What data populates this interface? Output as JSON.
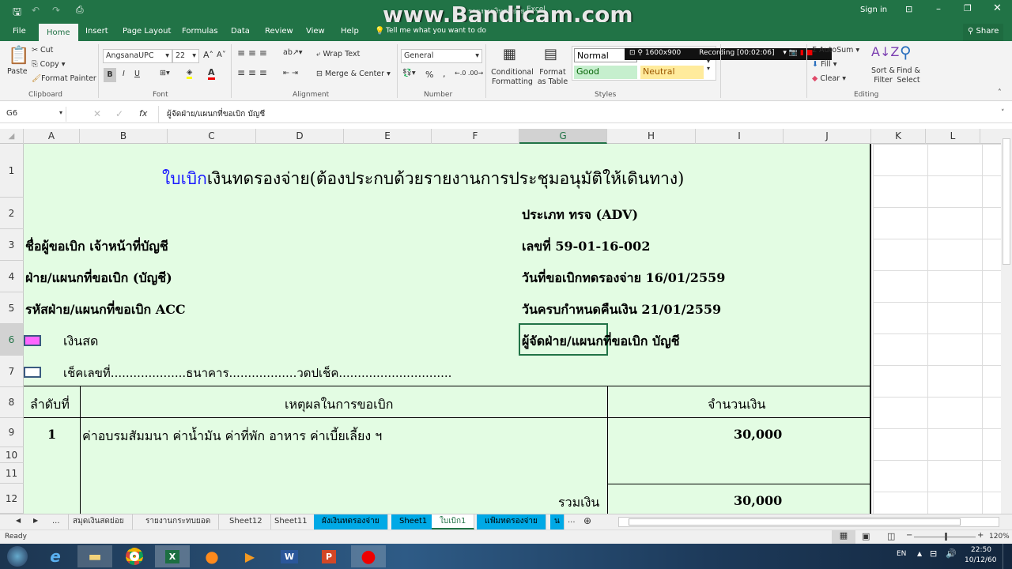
{
  "window": {
    "doc_title": "รายงานเงินสดย่อย",
    "app": "Excel",
    "sign_in": "Sign in",
    "share": "Share",
    "watermark": "www.Bandicam.com"
  },
  "qat": {
    "save": "save-icon",
    "undo": "undo-icon",
    "redo": "redo-icon",
    "preview": "print-preview-icon"
  },
  "ribbon_tabs": [
    "File",
    "Home",
    "Insert",
    "Page Layout",
    "Formulas",
    "Data",
    "Review",
    "View",
    "Help"
  ],
  "tell_me": "Tell me what you want to do",
  "clipboard": {
    "paste": "Paste",
    "cut": "Cut",
    "copy": "Copy",
    "format_painter": "Format Painter",
    "group": "Clipboard"
  },
  "font": {
    "name": "AngsanaUPC",
    "size": "22",
    "bold": "B",
    "italic": "I",
    "underline": "U",
    "group": "Font"
  },
  "alignment": {
    "wrap": "Wrap Text",
    "merge": "Merge & Center",
    "group": "Alignment"
  },
  "number": {
    "format": "General",
    "percent": "%",
    "comma": ",",
    "group": "Number"
  },
  "styles": {
    "conditional": "Conditional Formatting",
    "format_table": "Format as Table",
    "normal": "Normal",
    "good": "Good",
    "neutral": "Neutral",
    "group": "Styles"
  },
  "cells": {
    "title_blue": "ใบเบิก",
    "title_rest": "เงินทดรองจ่าย(ต้องประกบด้วยรายงานการประชุมอนุมัติให้เดินทาง)",
    "type": "ประเภท  ทรจ (ADV)",
    "requester": "ชื่อผู้ขอเบิก  เจ้าหน้าที่บัญชี",
    "doc_no": "เลขที่ 59-01-16-002",
    "department": "ฝ่าย/แผนกที่ขอเบิก (บัญชี)",
    "request_date": "วันที่ขอเบิกทดรองจ่าย 16/01/2559",
    "dept_code": "รหัสฝ่าย/แผนกที่ขอเบิก ACC",
    "due_date": "วันครบกำหนดคืนเงิน 21/01/2559",
    "cash": "เงินสด",
    "manager": "ผู้จัดฝ่าย/แผนกที่ขอเบิก บัญชี",
    "cheque": "เช็คเลขที่....................ธนาคาร..................วดปเช็ค..............................",
    "hdr_no": "ลำดับที่",
    "hdr_reason": "เหตุผลในการขอเบิก",
    "hdr_amount": "จำนวนเงิน",
    "item_no": "1",
    "item_desc": "ค่าอบรมสัมมนา ค่าน้ำมัน ค่าที่พัก อาหาร ค่าเบี้ยเลี้ยง ฯ",
    "item_amount": "30,000",
    "total_label": "รวมเงิน",
    "total_amount": "30,000"
  },
  "editing": {
    "autosum": "AutoSum",
    "fill": "Fill",
    "clear": "Clear",
    "sort": "Sort & Filter",
    "find": "Find & Select",
    "group": "Editing"
  },
  "recorder": {
    "resolution": "1600x900",
    "status": "Recording [00:02:06]"
  },
  "formula_bar": {
    "name_box": "G6",
    "formula": "ผู้จัดฝ่าย/แผนกที่ขอเบิก  บัญชี"
  },
  "columns": [
    "A",
    "B",
    "C",
    "D",
    "E",
    "F",
    "G",
    "H",
    "I",
    "J",
    "K",
    "L"
  ],
  "rows": [
    "1",
    "2",
    "3",
    "4",
    "5",
    "6",
    "7",
    "8",
    "9",
    "10",
    "11",
    "12"
  ],
  "checkbox_colors": {
    "cash": "#ff66ff",
    "cheque": "#ffffff"
  },
  "sheet_tabs": [
    "...",
    "สมุดเงินสดย่อย",
    "รายงานกระทบยอด",
    "Sheet12",
    "Sheet11",
    "ผังเงินทดรองจ่าย",
    "Sheet1",
    "ใบเบิก1",
    "แฟ้มทดรองจ่าย",
    "น",
    "..."
  ],
  "active_sheet": "ใบเบิก1",
  "status": {
    "ready": "Ready",
    "zoom": "120%"
  },
  "taskbar": {
    "lang": "EN",
    "time": "22:50",
    "date": "10/12/60"
  }
}
